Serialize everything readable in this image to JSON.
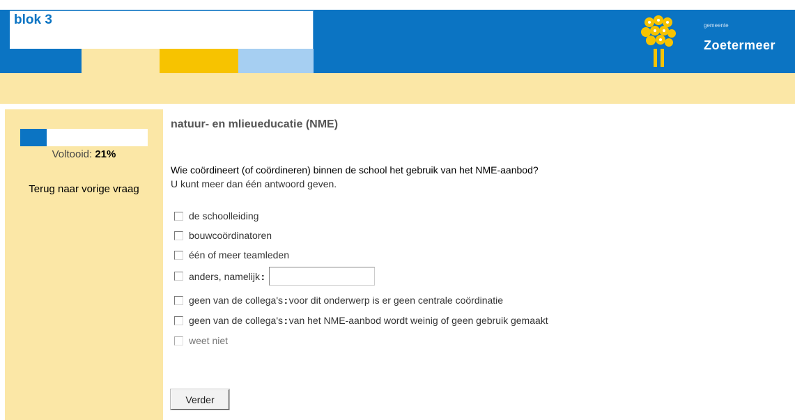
{
  "header": {
    "blok_title": "blok 3",
    "brand_small": "gemeente",
    "brand_name": "Zoetermeer",
    "logo_icon": "zoetermeer-flower-logo-icon",
    "colors": {
      "blue": "#0b74c3",
      "yellow": "#f7c300",
      "light_yellow": "#fbe7a6",
      "light_blue": "#a6cff2"
    }
  },
  "sidebar": {
    "progress_fraction": 0.21,
    "progress_label": "Voltooid:",
    "progress_value": "21%",
    "back_link": "Terug naar vorige vraag"
  },
  "main": {
    "section_title": "natuur- en mlieueducatie (NME)",
    "question": "Wie coördineert (of coördineren) binnen de school het gebruik van het NME-aanbod?",
    "hint": "U kunt meer dan één antwoord geven.",
    "options": [
      {
        "label": "de schoolleiding"
      },
      {
        "label": "bouwcoördinatoren"
      },
      {
        "label": "één of meer teamleden"
      },
      {
        "label": "anders, namelijk",
        "sep": ":",
        "input_value": ""
      },
      {
        "label": "geen van de collega's",
        "sep": ":",
        "rest": "voor dit onderwerp is er geen centrale coördinatie"
      },
      {
        "label": "geen van de collega's",
        "sep": ":",
        "rest": "van het NME-aanbod wordt weinig of geen gebruik gemaakt"
      },
      {
        "label": "weet niet"
      }
    ],
    "next_button": "Verder"
  }
}
